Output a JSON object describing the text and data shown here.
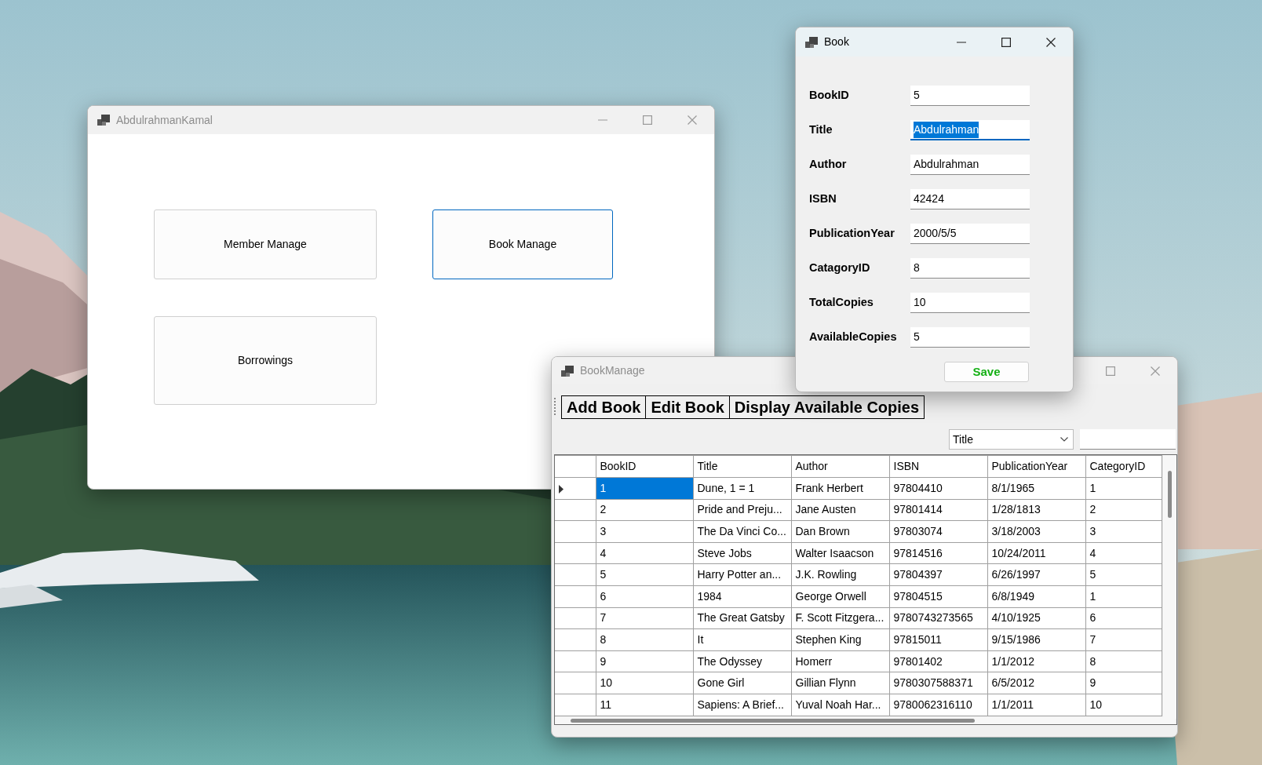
{
  "main_window": {
    "title": "AbdulrahmanKamal",
    "active": false,
    "buttons": [
      {
        "label": "Member Manage",
        "focused": false
      },
      {
        "label": "Book Manage",
        "focused": true
      },
      {
        "label": "Borrowings",
        "focused": false
      }
    ]
  },
  "book_window": {
    "title": "Book",
    "active": true,
    "fields": [
      {
        "label": "BookID",
        "value": "5",
        "focused": false
      },
      {
        "label": "Title",
        "value": "Abdulrahman",
        "focused": true
      },
      {
        "label": "Author",
        "value": "Abdulrahman",
        "focused": false
      },
      {
        "label": "ISBN",
        "value": "42424",
        "focused": false
      },
      {
        "label": "PublicationYear",
        "value": "2000/5/5",
        "focused": false
      },
      {
        "label": "CatagoryID",
        "value": "8",
        "focused": false
      },
      {
        "label": "TotalCopies",
        "value": "10",
        "focused": false
      },
      {
        "label": "AvailableCopies",
        "value": "5",
        "focused": false
      }
    ],
    "save_button": "Save"
  },
  "book_manage_window": {
    "title": "BookManage",
    "active": false,
    "toolbar": [
      "Add Book",
      "Edit Book",
      "Display Available Copies"
    ],
    "search_by": {
      "value": "Title"
    },
    "table": {
      "columns": [
        "BookID",
        "Title",
        "Author",
        "ISBN",
        "PublicationYear",
        "CategoryID"
      ],
      "rows": [
        {
          "cells": [
            "1",
            "Dune, 1 = 1",
            "Frank Herbert",
            "97804410",
            "8/1/1965",
            "1"
          ],
          "selected": true
        },
        {
          "cells": [
            "2",
            "Pride and Preju...",
            "Jane Austen",
            "97801414",
            "1/28/1813",
            "2"
          ],
          "selected": false
        },
        {
          "cells": [
            "3",
            "The Da Vinci Co...",
            "Dan Brown",
            "97803074",
            "3/18/2003",
            "3"
          ],
          "selected": false
        },
        {
          "cells": [
            "4",
            "Steve Jobs",
            "Walter Isaacson",
            "97814516",
            "10/24/2011",
            "4"
          ],
          "selected": false
        },
        {
          "cells": [
            "5",
            "Harry Potter an...",
            "J.K. Rowling",
            "97804397",
            "6/26/1997",
            "5"
          ],
          "selected": false
        },
        {
          "cells": [
            "6",
            "1984",
            "George Orwell",
            "97804515",
            "6/8/1949",
            "1"
          ],
          "selected": false
        },
        {
          "cells": [
            "7",
            "The Great Gatsby",
            "F. Scott Fitzgera...",
            "9780743273565",
            "4/10/1925",
            "6"
          ],
          "selected": false
        },
        {
          "cells": [
            "8",
            "It",
            "Stephen King",
            "97815011",
            "9/15/1986",
            "7"
          ],
          "selected": false
        },
        {
          "cells": [
            "9",
            "The Odyssey",
            "Homerr",
            "97801402",
            "1/1/2012",
            "8"
          ],
          "selected": false
        },
        {
          "cells": [
            "10",
            "Gone Girl",
            "Gillian Flynn",
            "9780307588371",
            "6/5/2012",
            "9"
          ],
          "selected": false
        },
        {
          "cells": [
            "11",
            "Sapiens: A Brief...",
            "Yuval Noah Har...",
            "9780062316110",
            "1/1/2011",
            "10"
          ],
          "selected": false
        }
      ]
    }
  }
}
